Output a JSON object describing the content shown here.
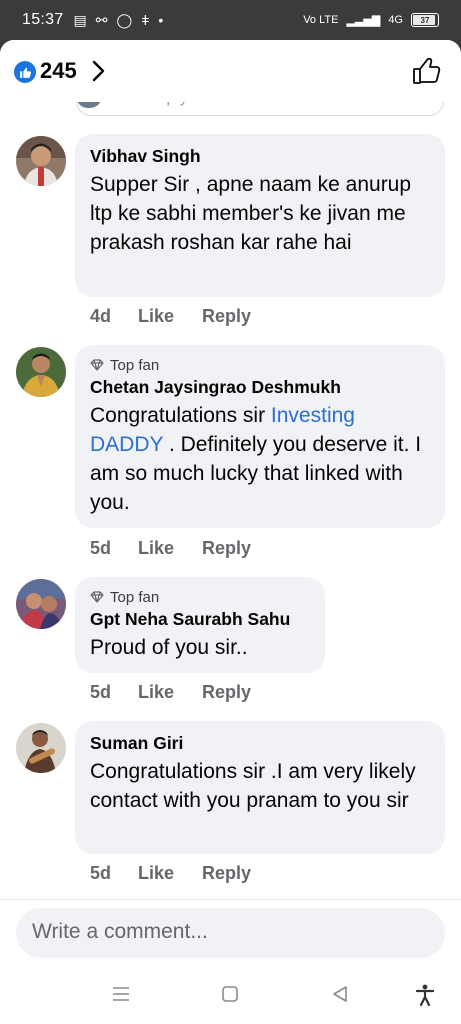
{
  "status_bar": {
    "time": "15:37",
    "signal_label": "Vo LTE",
    "network": "4G",
    "battery": "37"
  },
  "header": {
    "reaction_count": "245"
  },
  "previous_reply": {
    "placeholder": "Write a reply..."
  },
  "comments": [
    {
      "name": "Vibhav Singh",
      "top_fan": "",
      "text": "Supper Sir , apne naam ke anurup ltp ke sabhi member's ke jivan me prakash roshan kar rahe hai",
      "time": "4d",
      "like": "Like",
      "reply": "Reply"
    },
    {
      "name": "Chetan Jaysingrao Deshmukh",
      "top_fan": "Top fan",
      "text_before": "Congratulations sir ",
      "mention": "Investing DADDY",
      "text_after": " . Definitely you deserve it. I am so much lucky that linked with you.",
      "time": "5d",
      "like": "Like",
      "reply": "Reply"
    },
    {
      "name": "Gpt Neha Saurabh Sahu",
      "top_fan": "Top fan",
      "text": "Proud of you sir..",
      "time": "5d",
      "like": "Like",
      "reply": "Reply"
    },
    {
      "name": "Suman Giri",
      "top_fan": "",
      "text": "Congratulations sir .I am very likely contact with you pranam to you sir",
      "time": "5d",
      "like": "Like",
      "reply": "Reply"
    }
  ],
  "composer": {
    "placeholder": "Write a comment..."
  },
  "colors": {
    "accent": "#1b74e4",
    "bubble": "#f0f2f5",
    "meta": "#65676b",
    "mention": "#2d6fd0"
  }
}
